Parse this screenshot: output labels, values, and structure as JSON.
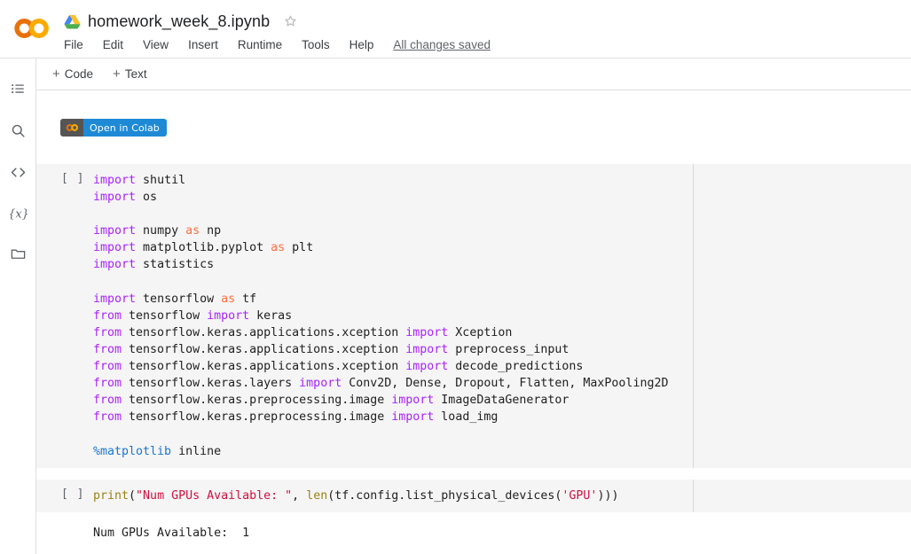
{
  "header": {
    "logo_icon": "colab-logo",
    "drive_icon": "google-drive-icon",
    "filename": "homework_week_8.ipynb",
    "star_icon": "star-outline-icon",
    "menu_items": [
      {
        "label": "File"
      },
      {
        "label": "Edit"
      },
      {
        "label": "View"
      },
      {
        "label": "Insert"
      },
      {
        "label": "Runtime"
      },
      {
        "label": "Tools"
      },
      {
        "label": "Help"
      }
    ],
    "save_status": "All changes saved"
  },
  "sidebar": {
    "items": [
      {
        "name": "table-of-contents",
        "icon": "list-icon"
      },
      {
        "name": "search",
        "icon": "search-icon"
      },
      {
        "name": "code-snippets",
        "icon": "code-brackets-icon"
      },
      {
        "name": "variables",
        "icon": "variables-icon"
      },
      {
        "name": "files",
        "icon": "folder-icon"
      }
    ]
  },
  "toolbar": {
    "add_code_label": "Code",
    "add_text_label": "Text",
    "plus_glyph": "+"
  },
  "notebook": {
    "badge": {
      "logo_icon": "colab-logo-small",
      "label": "Open in Colab",
      "left_color": "#555555",
      "right_color": "#1e8ad6"
    },
    "cells": [
      {
        "name": "code-cell-imports",
        "execution_label": "[ ]",
        "lines": [
          [
            {
              "t": "import",
              "c": "k"
            },
            {
              "t": " shutil",
              "c": "pl"
            }
          ],
          [
            {
              "t": "import",
              "c": "k"
            },
            {
              "t": " os",
              "c": "pl"
            }
          ],
          [],
          [
            {
              "t": "import",
              "c": "k"
            },
            {
              "t": " numpy ",
              "c": "pl"
            },
            {
              "t": "as",
              "c": "kw2"
            },
            {
              "t": " np",
              "c": "pl"
            }
          ],
          [
            {
              "t": "import",
              "c": "k"
            },
            {
              "t": " matplotlib.pyplot ",
              "c": "pl"
            },
            {
              "t": "as",
              "c": "kw2"
            },
            {
              "t": " plt",
              "c": "pl"
            }
          ],
          [
            {
              "t": "import",
              "c": "k"
            },
            {
              "t": " statistics",
              "c": "pl"
            }
          ],
          [],
          [
            {
              "t": "import",
              "c": "k"
            },
            {
              "t": " tensorflow ",
              "c": "pl"
            },
            {
              "t": "as",
              "c": "kw2"
            },
            {
              "t": " tf",
              "c": "pl"
            }
          ],
          [
            {
              "t": "from",
              "c": "k"
            },
            {
              "t": " tensorflow ",
              "c": "pl"
            },
            {
              "t": "import",
              "c": "k"
            },
            {
              "t": " keras",
              "c": "pl"
            }
          ],
          [
            {
              "t": "from",
              "c": "k"
            },
            {
              "t": " tensorflow.keras.applications.xception ",
              "c": "pl"
            },
            {
              "t": "import",
              "c": "k"
            },
            {
              "t": " Xception",
              "c": "pl"
            }
          ],
          [
            {
              "t": "from",
              "c": "k"
            },
            {
              "t": " tensorflow.keras.applications.xception ",
              "c": "pl"
            },
            {
              "t": "import",
              "c": "k"
            },
            {
              "t": " preprocess_input",
              "c": "pl"
            }
          ],
          [
            {
              "t": "from",
              "c": "k"
            },
            {
              "t": " tensorflow.keras.applications.xception ",
              "c": "pl"
            },
            {
              "t": "import",
              "c": "k"
            },
            {
              "t": " decode_predictions",
              "c": "pl"
            }
          ],
          [
            {
              "t": "from",
              "c": "k"
            },
            {
              "t": " tensorflow.keras.layers ",
              "c": "pl"
            },
            {
              "t": "import",
              "c": "k"
            },
            {
              "t": " Conv2D, Dense, Dropout, Flatten, MaxPooling2D",
              "c": "pl"
            }
          ],
          [
            {
              "t": "from",
              "c": "k"
            },
            {
              "t": " tensorflow.keras.preprocessing.image ",
              "c": "pl"
            },
            {
              "t": "import",
              "c": "k"
            },
            {
              "t": " ImageDataGenerator",
              "c": "pl"
            }
          ],
          [
            {
              "t": "from",
              "c": "k"
            },
            {
              "t": " tensorflow.keras.preprocessing.image ",
              "c": "pl"
            },
            {
              "t": "import",
              "c": "k"
            },
            {
              "t": " load_img",
              "c": "pl"
            }
          ],
          [],
          [
            {
              "t": "%matplotlib",
              "c": "mg"
            },
            {
              "t": " inline",
              "c": "pl"
            }
          ]
        ]
      },
      {
        "name": "code-cell-gpu-check",
        "execution_label": "[ ]",
        "lines": [
          [
            {
              "t": "print",
              "c": "bi"
            },
            {
              "t": "(",
              "c": "pl"
            },
            {
              "t": "\"Num GPUs Available: \"",
              "c": "st"
            },
            {
              "t": ", ",
              "c": "pl"
            },
            {
              "t": "len",
              "c": "bi"
            },
            {
              "t": "(tf.config.list_physical_devices(",
              "c": "pl"
            },
            {
              "t": "'GPU'",
              "c": "st"
            },
            {
              "t": ")))",
              "c": "pl"
            }
          ]
        ],
        "output": "Num GPUs Available:  1"
      }
    ]
  }
}
